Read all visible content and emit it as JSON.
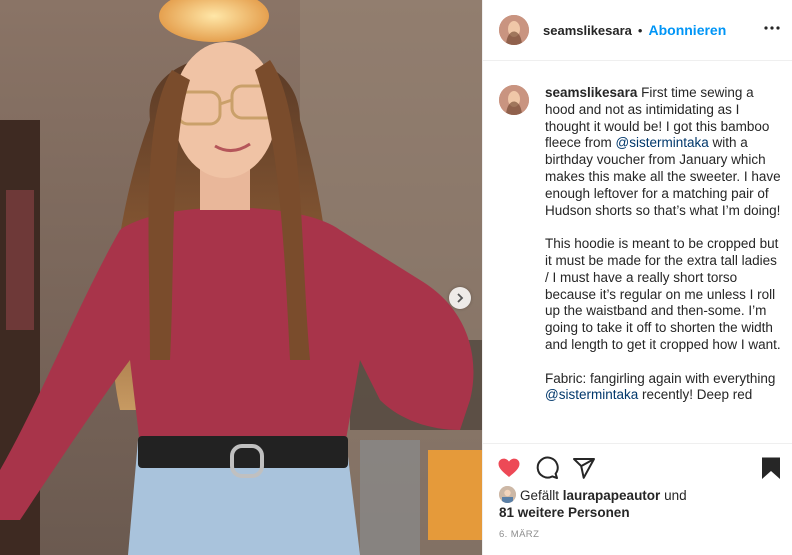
{
  "header": {
    "username": "seamslikesara",
    "separator": "•",
    "follow_label": "Abonnieren"
  },
  "caption": {
    "username": "seamslikesara",
    "p1_before": "First time sewing a hood and not as intimidating as I thought it would be! I got this bamboo fleece from ",
    "p1_mention": "@sistermintaka",
    "p1_after": " with a birthday voucher from January which makes this make all the sweeter. I have enough leftover for a matching pair of Hudson shorts so that’s what I’m doing!",
    "p2": "This hoodie is meant to be cropped but it must be made for the extra tall ladies / I must have a really short torso because it’s regular on me unless I roll up the waistband and then-some. I’m going to take it off to shorten the width and length to get it cropped how I want.",
    "p3_before": "Fabric: fangirling again with everything ",
    "p3_mention": "@sistermintaka",
    "p3_after": " recently! Deep red"
  },
  "likes": {
    "prefix": "Gefällt ",
    "user": "laurapapeautor",
    "mid": " und",
    "others": "81 weitere Personen"
  },
  "date": "6. MÄRZ",
  "icons": {
    "like": "heart-filled-icon",
    "comment": "comment-icon",
    "share": "paper-plane-icon",
    "save": "bookmark-filled-icon",
    "more": "more-horizontal-icon",
    "next": "chevron-right-icon"
  },
  "colors": {
    "like_red": "#ed4956",
    "link_blue": "#00376b",
    "follow_blue": "#0095f6",
    "hoodie": "#a8344a"
  }
}
